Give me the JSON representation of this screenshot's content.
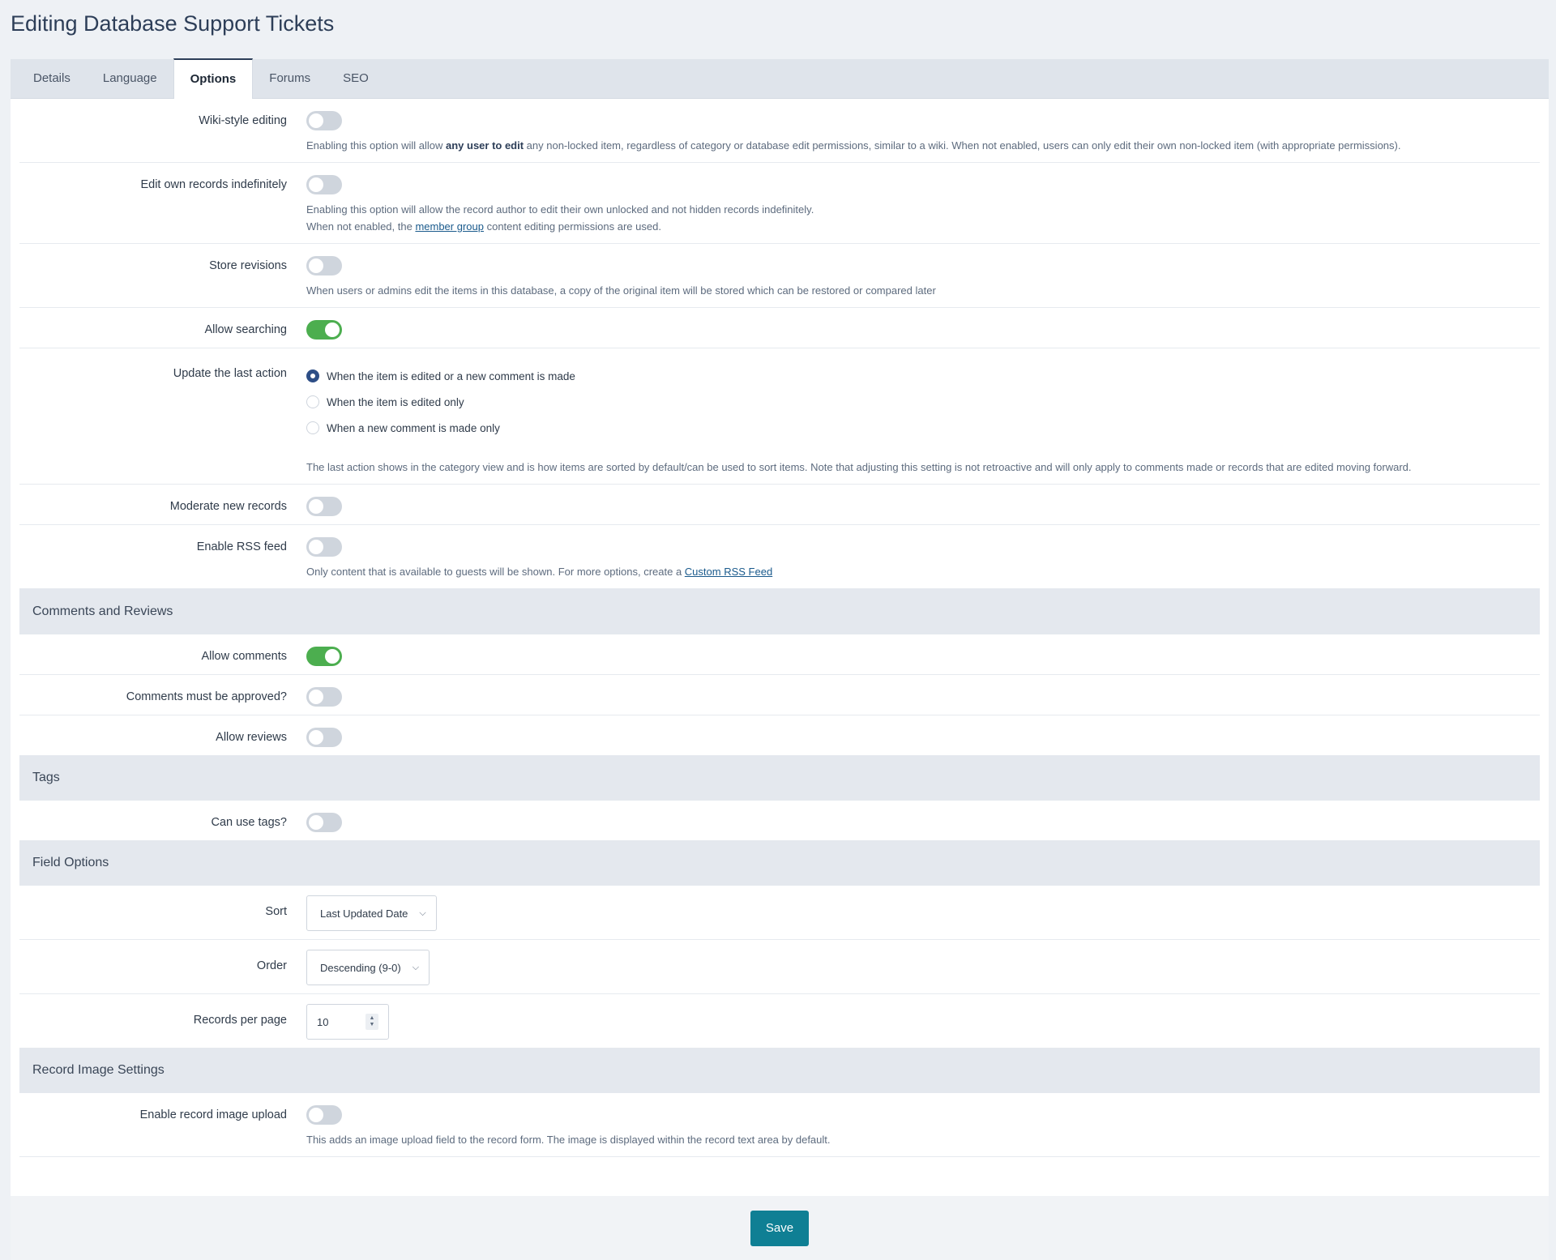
{
  "title": "Editing Database Support Tickets",
  "tabs": [
    "Details",
    "Language",
    "Options",
    "Forums",
    "SEO"
  ],
  "options": {
    "wiki": {
      "label": "Wiki-style editing",
      "desc_pre": "Enabling this option will allow ",
      "desc_bold": "any user to edit",
      "desc_post": " any non-locked item, regardless of category or database edit permissions, similar to a wiki. When not enabled, users can only edit their own non-locked item (with appropriate permissions)."
    },
    "edit_own": {
      "label": "Edit own records indefinitely",
      "desc_line1": "Enabling this option will allow the record author to edit their own unlocked and not hidden records indefinitely.",
      "desc_line2_pre": "When not enabled, the ",
      "desc_link": "member group",
      "desc_line2_post": " content editing permissions are used."
    },
    "revisions": {
      "label": "Store revisions",
      "desc": "When users or admins edit the items in this database, a copy of the original item will be stored which can be restored or compared later"
    },
    "searching": {
      "label": "Allow searching"
    },
    "last_action": {
      "label": "Update the last action",
      "options": [
        "When the item is edited or a new comment is made",
        "When the item is edited only",
        "When a new comment is made only"
      ],
      "desc": "The last action shows in the category view and is how items are sorted by default/can be used to sort items. Note that adjusting this setting is not retroactive and will only apply to comments made or records that are edited moving forward."
    },
    "moderate": {
      "label": "Moderate new records"
    },
    "rss": {
      "label": "Enable RSS feed",
      "desc_pre": "Only content that is available to guests will be shown. For more options, create a ",
      "desc_link": "Custom RSS Feed"
    }
  },
  "comments_section": {
    "title": "Comments and Reviews",
    "allow_comments": "Allow comments",
    "approve_comments": "Comments must be approved?",
    "allow_reviews": "Allow reviews"
  },
  "tags_section": {
    "title": "Tags",
    "can_use_tags": "Can use tags?"
  },
  "field_section": {
    "title": "Field Options",
    "sort_label": "Sort",
    "sort_value": "Last Updated Date",
    "order_label": "Order",
    "order_value": "Descending (9-0)",
    "per_page_label": "Records per page",
    "per_page_value": "10"
  },
  "image_section": {
    "title": "Record Image Settings",
    "upload_label": "Enable record image upload",
    "upload_desc": "This adds an image upload field to the record form. The image is displayed within the record text area by default."
  },
  "save_label": "Save"
}
